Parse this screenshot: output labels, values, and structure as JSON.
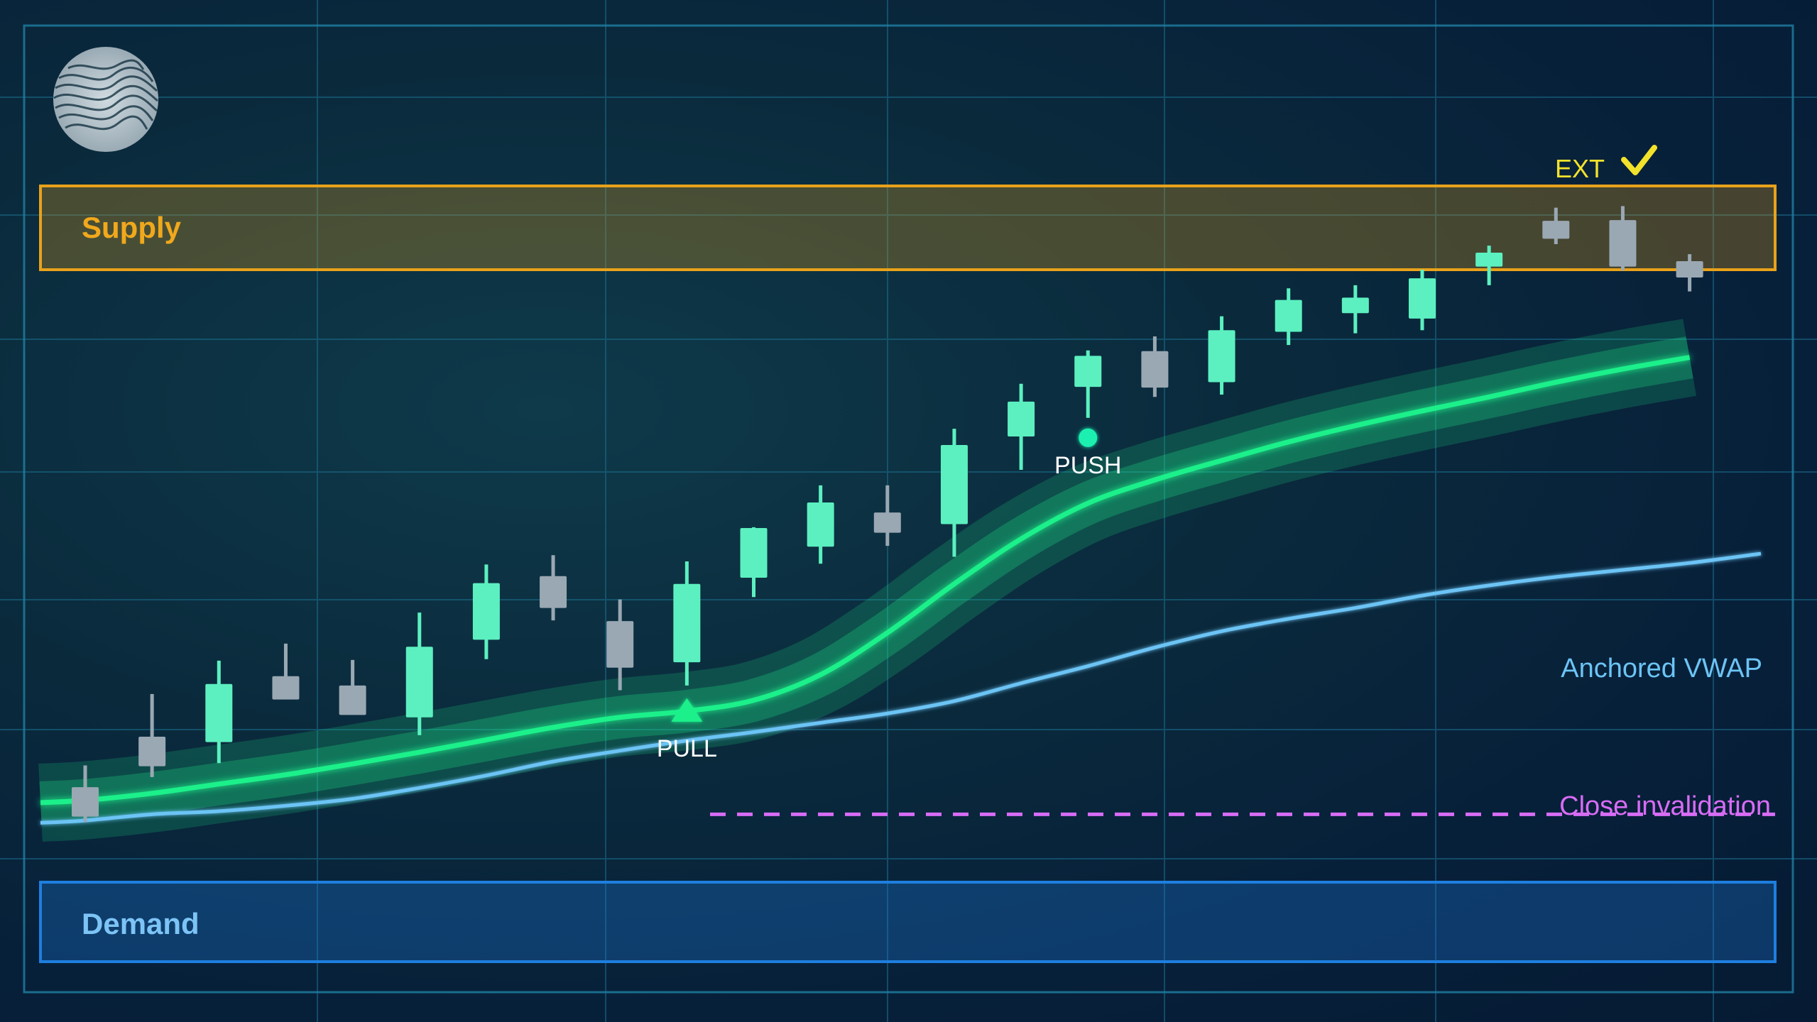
{
  "zones": {
    "supply_label": "Supply",
    "demand_label": "Demand"
  },
  "annotations": {
    "ext_label": "EXT",
    "push_label": "PUSH",
    "pull_label": "PULL",
    "vwap_label": "Anchored VWAP",
    "invalidation_label": "Close invalidation"
  },
  "colors": {
    "supply": "#e8a21a",
    "demand": "#1e7fe0",
    "bull": "#5cf0c0",
    "bear": "#9aa8b3",
    "ema": "#1ef08a",
    "vwap": "#6cc4f5",
    "invalidation": "#d86cf5",
    "ext": "#f2e22a",
    "grid": "#1b6f8f"
  },
  "icons": {
    "logo": "fingerprint-wave-logo-icon",
    "ext_check": "checkmark-icon",
    "pull_marker": "triangle-up-icon",
    "push_marker": "dot-icon"
  },
  "chart_data": {
    "type": "candlestick",
    "note_units": "price units (unlabeled axis)",
    "ylim": [
      0,
      100
    ],
    "grid": true,
    "candles": [
      {
        "o": 22.5,
        "h": 25.3,
        "l": 18.0,
        "c": 18.7
      },
      {
        "o": 29.0,
        "h": 34.5,
        "l": 23.8,
        "c": 25.2
      },
      {
        "o": 28.3,
        "h": 38.8,
        "l": 25.6,
        "c": 35.8
      },
      {
        "o": 36.8,
        "h": 41.0,
        "l": 34.0,
        "c": 33.8
      },
      {
        "o": 35.6,
        "h": 38.9,
        "l": 32.2,
        "c": 31.8
      },
      {
        "o": 31.5,
        "h": 45.0,
        "l": 29.2,
        "c": 40.6
      },
      {
        "o": 41.5,
        "h": 51.2,
        "l": 39.0,
        "c": 48.8
      },
      {
        "o": 49.7,
        "h": 52.4,
        "l": 44.0,
        "c": 45.6
      },
      {
        "o": 43.9,
        "h": 46.7,
        "l": 35.0,
        "c": 37.9
      },
      {
        "o": 38.6,
        "h": 51.6,
        "l": 35.6,
        "c": 48.7
      },
      {
        "o": 49.5,
        "h": 56.0,
        "l": 47.0,
        "c": 55.9
      },
      {
        "o": 53.5,
        "h": 61.4,
        "l": 51.3,
        "c": 59.2
      },
      {
        "o": 57.9,
        "h": 61.4,
        "l": 53.6,
        "c": 55.3
      },
      {
        "o": 56.4,
        "h": 68.7,
        "l": 52.2,
        "c": 66.6
      },
      {
        "o": 67.7,
        "h": 74.5,
        "l": 63.4,
        "c": 72.2
      },
      {
        "o": 74.1,
        "h": 78.8,
        "l": 70.1,
        "c": 78.1
      },
      {
        "o": 78.7,
        "h": 80.6,
        "l": 72.8,
        "c": 74.0
      },
      {
        "o": 74.7,
        "h": 83.2,
        "l": 73.1,
        "c": 81.4
      },
      {
        "o": 81.2,
        "h": 86.8,
        "l": 79.5,
        "c": 85.3
      },
      {
        "o": 83.6,
        "h": 87.2,
        "l": 81.0,
        "c": 85.6
      },
      {
        "o": 82.9,
        "h": 89.2,
        "l": 81.4,
        "c": 88.1
      },
      {
        "o": 89.6,
        "h": 92.3,
        "l": 87.2,
        "c": 91.4
      },
      {
        "o": 95.5,
        "h": 97.2,
        "l": 92.5,
        "c": 93.2
      },
      {
        "o": 95.6,
        "h": 97.4,
        "l": 89.1,
        "c": 89.6
      },
      {
        "o": 90.3,
        "h": 91.2,
        "l": 86.4,
        "c": 88.2
      }
    ],
    "ema_line": [
      20.8,
      21.7,
      22.9,
      24.1,
      25.5,
      27.0,
      28.6,
      30.2,
      31.5,
      32.3,
      33.7,
      37.0,
      42.4,
      48.7,
      54.5,
      59.1,
      62.1,
      64.6,
      67.0,
      69.1,
      71.0,
      72.8,
      74.7,
      76.4,
      77.9
    ],
    "vwap_line": [
      18.2,
      19.0,
      19.4,
      20.1,
      21.0,
      22.4,
      24.0,
      25.8,
      27.2,
      28.5,
      29.6,
      30.8,
      32.0,
      33.6,
      35.9,
      38.1,
      40.5,
      42.6,
      44.2,
      45.6,
      47.2,
      48.5,
      49.6,
      50.5,
      51.4
    ],
    "supply_zone": [
      94.4,
      100.0
    ],
    "demand_zone": [
      1.0,
      6.3
    ],
    "close_invalidation": 19.0,
    "pull_index": 9,
    "push_index": 15,
    "ext_index": 22
  }
}
